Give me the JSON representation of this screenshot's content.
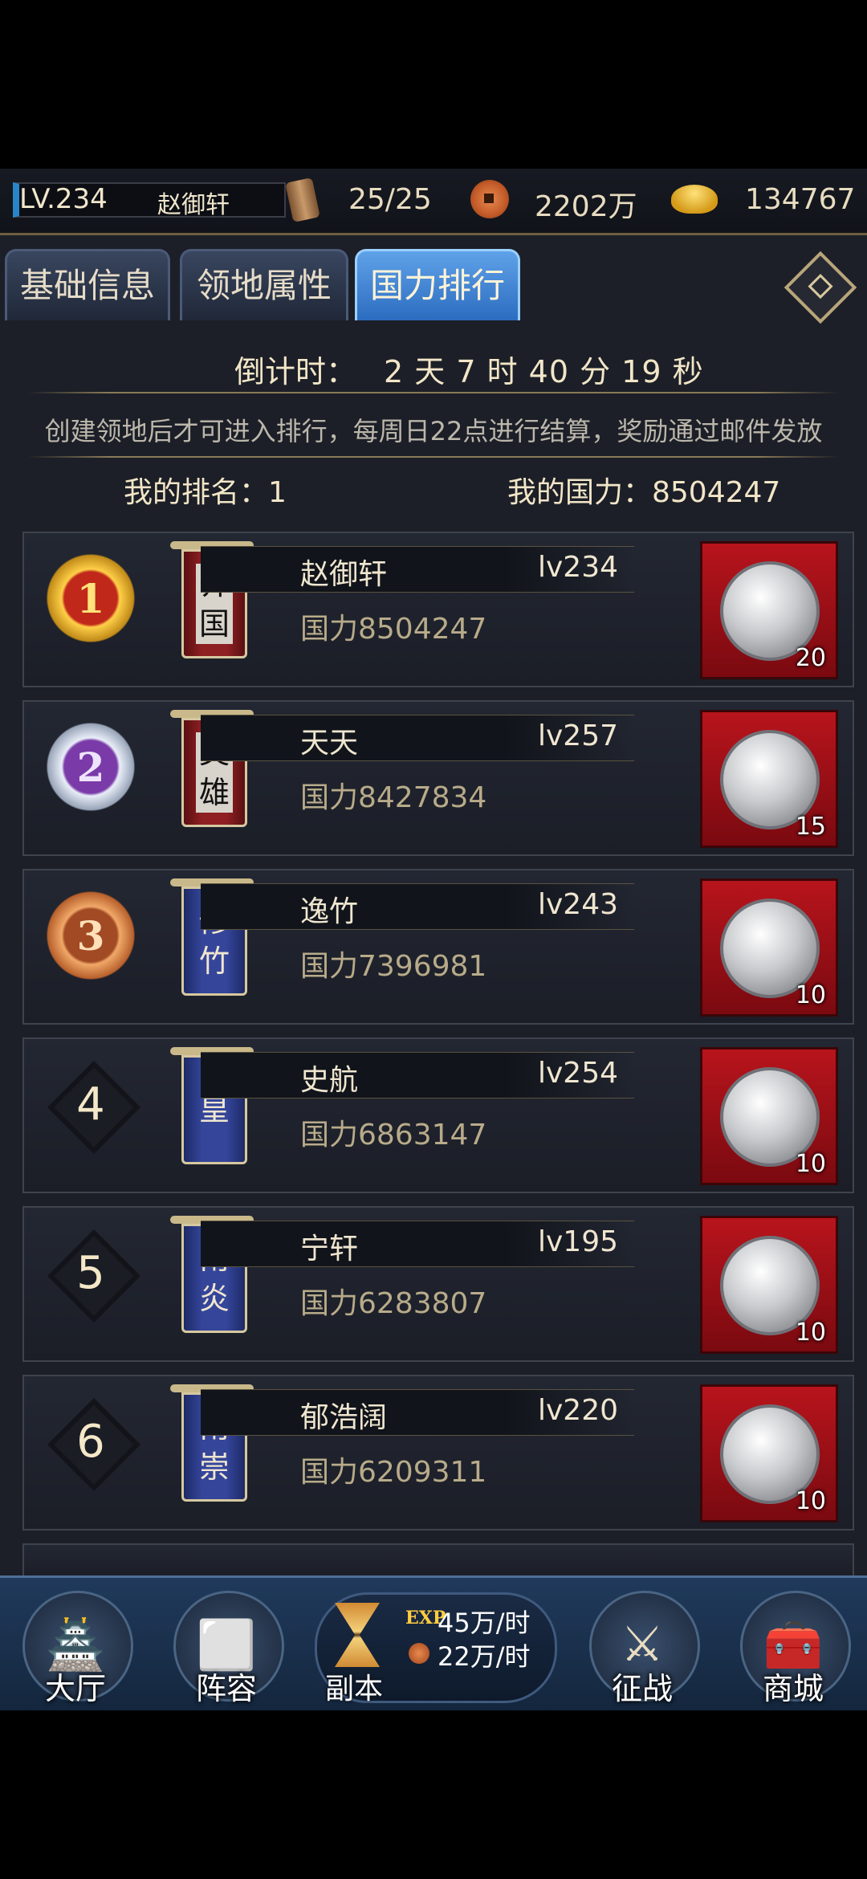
{
  "status": {
    "level": "LV.234",
    "player_name": "赵御轩",
    "stamina": "25/25",
    "coins": "2202万",
    "gold": "134767"
  },
  "tabs": [
    "基础信息",
    "领地属性",
    "国力排行"
  ],
  "countdown": {
    "label": "倒计时：",
    "value": "2 天 7 时 40 分 19 秒"
  },
  "notice": "创建领地后才可进入排行，每周日22点进行结算，奖励通过邮件发放",
  "my_rank": "我的排名：1",
  "my_power": "我的国力：8504247",
  "rankings": [
    {
      "rank": "1",
      "banner": [
        "齐",
        "国"
      ],
      "name": "赵御轩",
      "level": "lv234",
      "power": "国力8504247",
      "reward_qty": "20"
    },
    {
      "rank": "2",
      "banner": [
        "英",
        "雄"
      ],
      "name": "天天",
      "level": "lv257",
      "power": "国力8427834",
      "reward_qty": "15"
    },
    {
      "rank": "3",
      "banner": [
        "修",
        "竹"
      ],
      "name": "逸竹",
      "level": "lv243",
      "power": "国力7396981",
      "reward_qty": "10"
    },
    {
      "rank": "4",
      "banner": [
        "皇"
      ],
      "name": "史航",
      "level": "lv254",
      "power": "国力6863147",
      "reward_qty": "10"
    },
    {
      "rank": "5",
      "banner": [
        "南",
        "炎"
      ],
      "name": "宁轩",
      "level": "lv195",
      "power": "国力6283807",
      "reward_qty": "10"
    },
    {
      "rank": "6",
      "banner": [
        "南",
        "崇"
      ],
      "name": "郁浩阔",
      "level": "lv220",
      "power": "国力6209311",
      "reward_qty": "10"
    }
  ],
  "bottom_nav": {
    "hall": "大厅",
    "lineup": "阵容",
    "dungeon": "副本",
    "exp_tag": "EXP",
    "exp_rate": "45万/时",
    "coin_rate": "22万/时",
    "battle": "征战",
    "shop": "商城"
  },
  "colors": {
    "active_tab": "#2c6cc0",
    "reward_bg": "#b8141c",
    "name_text": "#f0e6d0",
    "power_text": "#b8ab8a"
  }
}
